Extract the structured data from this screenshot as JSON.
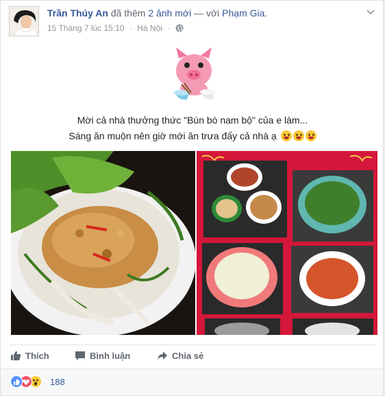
{
  "post": {
    "author": "Trần Thúy An",
    "action": "đã thêm",
    "photos_link": "2 ảnh mới",
    "with_text": "— với",
    "tagged": "Phạm Gia",
    "period": ".",
    "date": "15 Tháng 7 lúc 15:10",
    "separator": "·",
    "location": "Hà Nội",
    "location_separator": "·",
    "message_line1": "Mời cả nhà thưởng thức \"Bún bò nam bộ\" của e làm...",
    "message_line2": "Sáng ăn muộn nên giờ mới ăn trưa đấy cả nhà ạ",
    "audience_icon": "globe-icon",
    "options_icon": "chevron-down-icon"
  },
  "actions": {
    "like": "Thích",
    "comment": "Bình luận",
    "share": "Chia sẻ"
  },
  "reactions": {
    "count": "188",
    "types": [
      "like",
      "love",
      "wow"
    ]
  },
  "colors": {
    "link": "#365899",
    "muted": "#90949c",
    "action_text": "#616770",
    "like_blue": "#5890ff",
    "love_red": "#f25268",
    "wow_yellow": "#f7c936",
    "collage_red": "#d4173a"
  }
}
